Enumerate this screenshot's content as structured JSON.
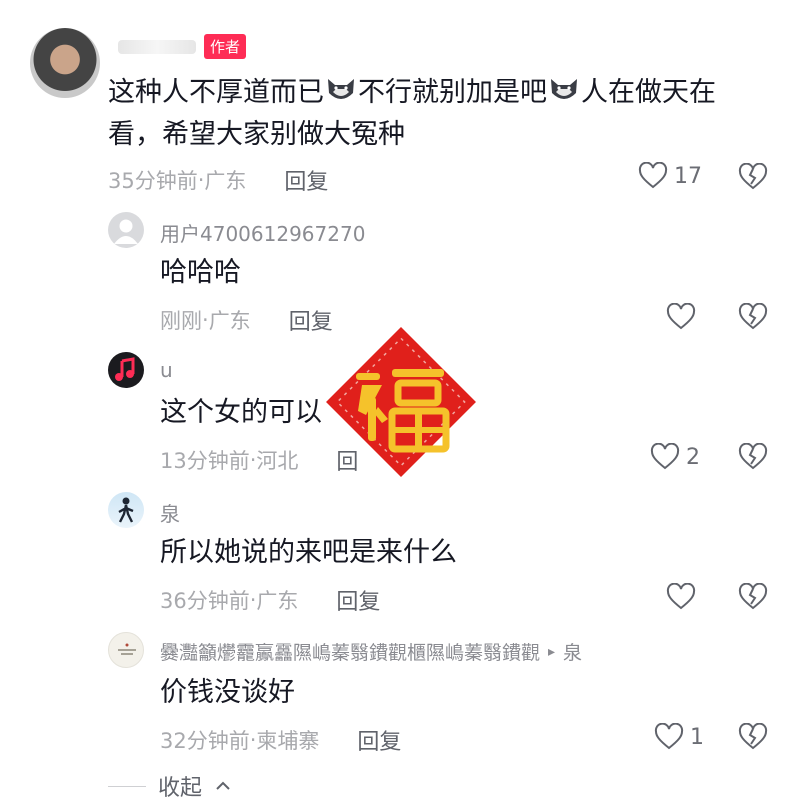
{
  "comments": [
    {
      "author_badge": "作者",
      "text_parts": [
        "这种人不厚道而已",
        "不行就别加是吧",
        "人在做天在",
        "看，希望大家别做大冤种"
      ],
      "meta_time": "35分钟前",
      "meta_sep": " · ",
      "meta_location": "广东",
      "reply": "回复",
      "likes": "17"
    },
    {
      "username": "用户4700612967270",
      "text": "哈哈哈",
      "meta_time": "刚刚",
      "meta_sep": " · ",
      "meta_location": "广东",
      "reply": "回复",
      "likes": ""
    },
    {
      "username": "u",
      "text": "这个女的可以",
      "meta_time": "13分钟前",
      "meta_sep": " · ",
      "meta_location": "河北",
      "reply": "回",
      "likes": "2"
    },
    {
      "username": "泉",
      "text": "所以她说的来吧是来什么",
      "meta_time": "36分钟前",
      "meta_sep": " · ",
      "meta_location": "广东",
      "reply": "回复",
      "likes": ""
    },
    {
      "username": "爨灩籲爩龗鸁靐隰嶋蓁翳鐨觀櫃隰嶋蓁翳鐨觀",
      "reply_arrow": "▸",
      "reply_to": "泉",
      "text": "价钱没谈好",
      "meta_time": "32分钟前",
      "meta_sep": " · ",
      "meta_location": "柬埔寨",
      "reply": "回复",
      "likes": "1"
    }
  ],
  "collapse_label": "收起",
  "colors": {
    "accent": "#fe2c55",
    "text": "#161823",
    "meta": "#a8a9ad"
  },
  "icons": [
    "heart-outline-icon",
    "broken-heart-icon",
    "wolf-emoji-icon",
    "fu-sticker",
    "chevron-up-icon"
  ]
}
